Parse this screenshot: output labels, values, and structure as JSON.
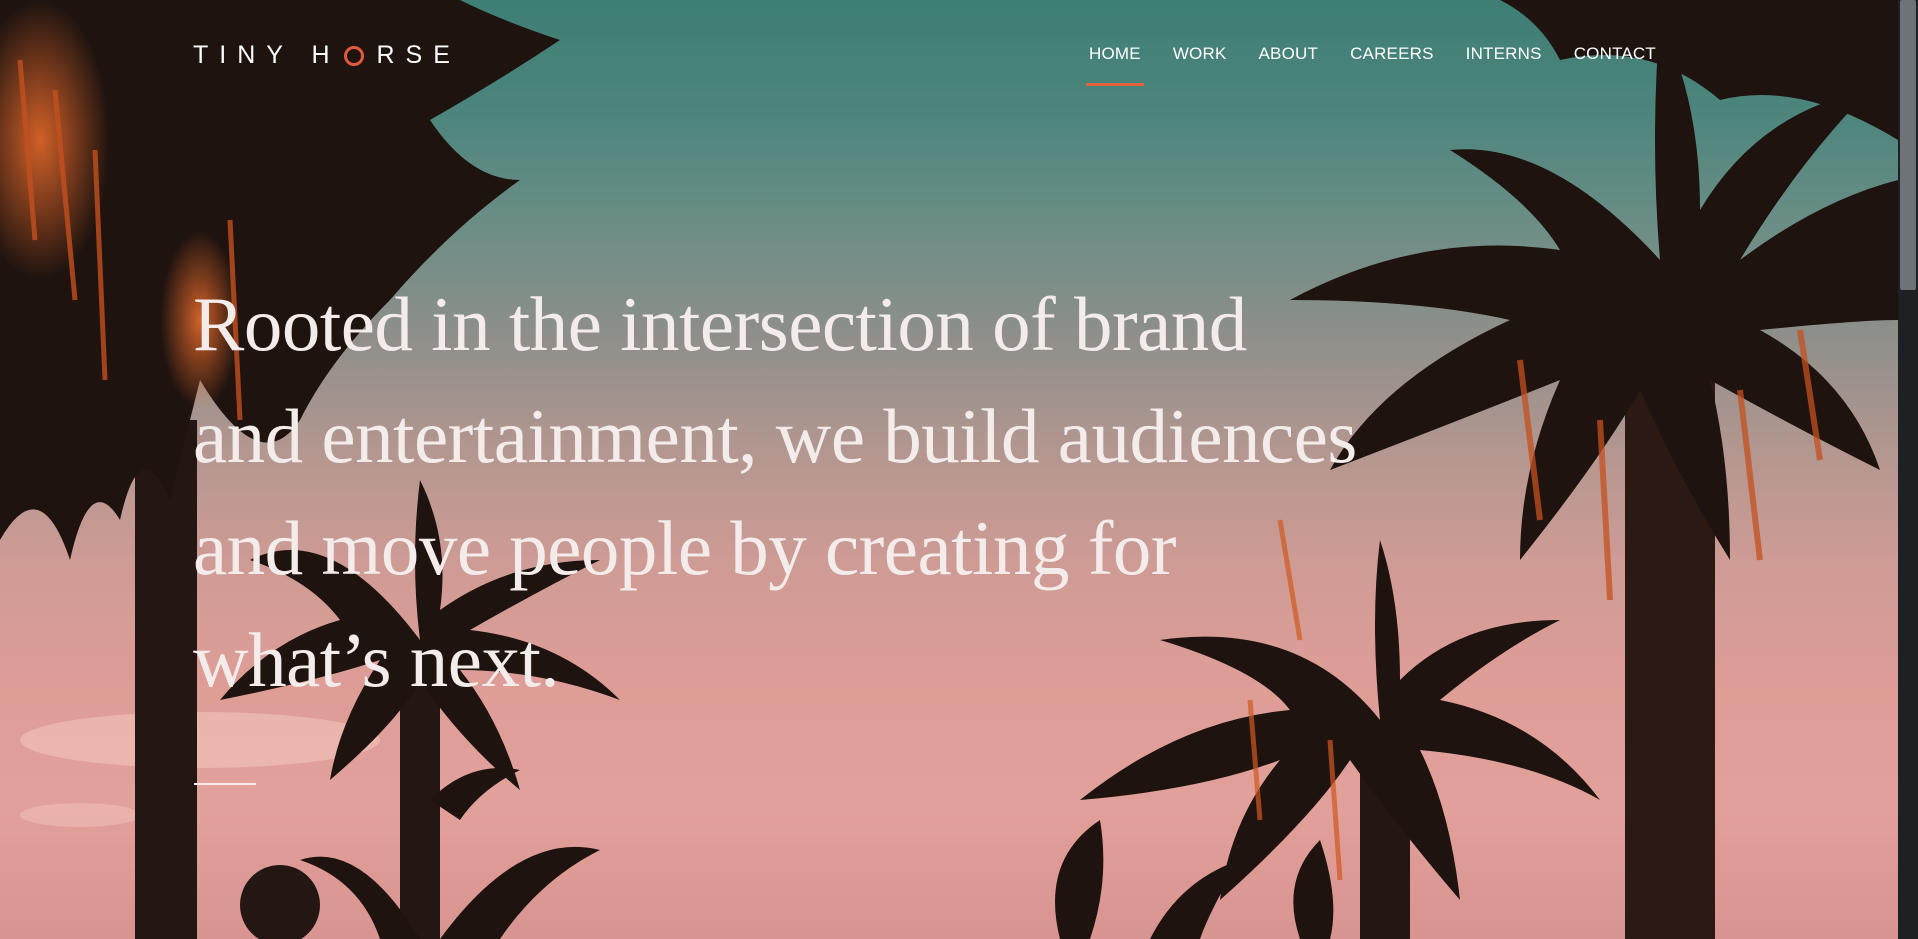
{
  "brand": {
    "logo_left": "TINY H",
    "logo_right": "RSE",
    "accent_color": "#e2613f"
  },
  "nav": {
    "items": [
      {
        "label": "HOME",
        "active": true
      },
      {
        "label": "WORK",
        "active": false
      },
      {
        "label": "ABOUT",
        "active": false
      },
      {
        "label": "CAREERS",
        "active": false
      },
      {
        "label": "INTERNS",
        "active": false
      },
      {
        "label": "CONTACT",
        "active": false
      }
    ]
  },
  "hero": {
    "headline": "Rooted in the intersection of brand and entertainment, we build audiences and move people by creating for what’s next.",
    "background": "palm-trees-sunset-photo"
  }
}
